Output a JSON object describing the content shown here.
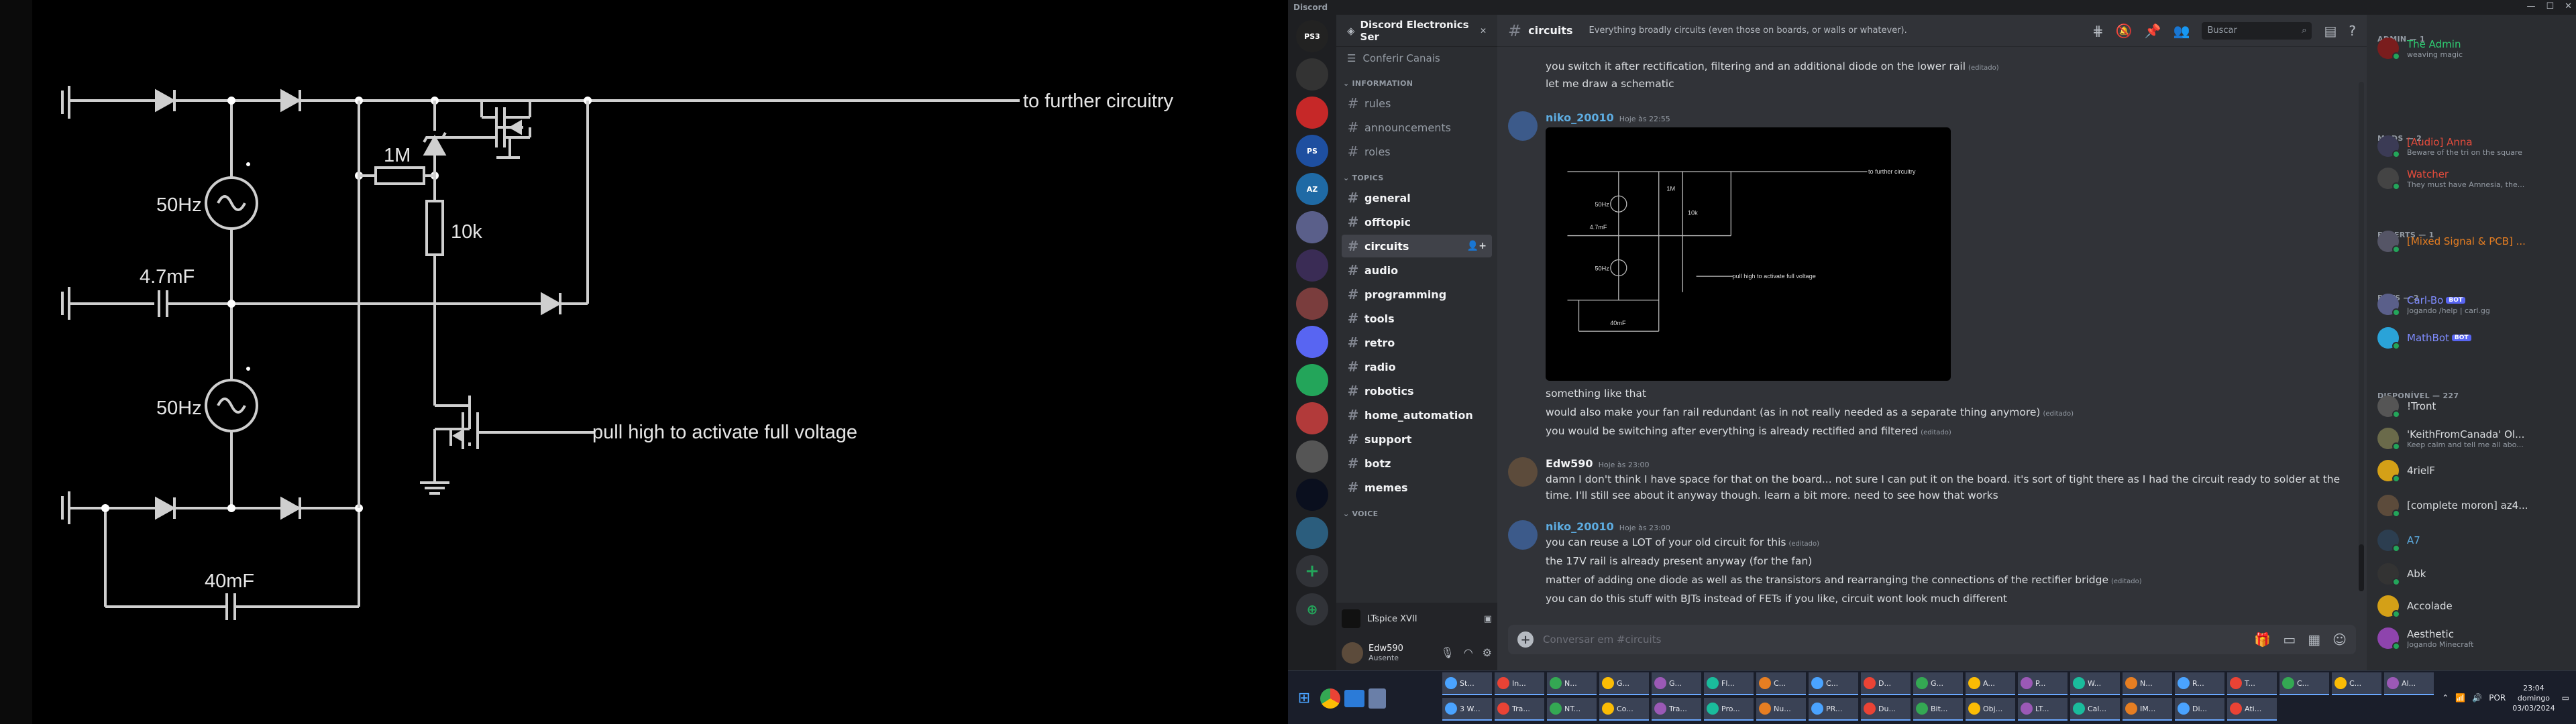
{
  "schematic": {
    "labels": {
      "out": "to further circuitry",
      "freq1": "50Hz",
      "freq2": "50Hz",
      "cap1": "4.7mF",
      "cap2": "40mF",
      "r1": "1M",
      "r2": "10k",
      "ctrl": "pull high to activate full voltage"
    }
  },
  "window": {
    "title": "Discord"
  },
  "servers": [
    {
      "name": "PS3",
      "color": "#222"
    },
    {
      "name": "",
      "color": "#333"
    },
    {
      "name": "",
      "color": "#c62828"
    },
    {
      "name": "PS",
      "color": "#1e4fa0"
    },
    {
      "name": "AZ",
      "color": "#1f6aa5"
    },
    {
      "name": "",
      "color": "#5a5f8a"
    },
    {
      "name": "",
      "color": "#3a2c55"
    },
    {
      "name": "",
      "color": "#7a3d3d"
    },
    {
      "name": "",
      "color": "#5865f2"
    },
    {
      "name": "",
      "color": "#23a55a"
    },
    {
      "name": "",
      "color": "#b23a3a"
    },
    {
      "name": "",
      "color": "#555"
    },
    {
      "name": "",
      "color": "#0a0f1e"
    },
    {
      "name": "",
      "color": "#2b5d7d"
    }
  ],
  "guild": {
    "name": "Discord Electronics Ser",
    "browse": "Conferir Canais"
  },
  "categories": {
    "info": "INFORMATION",
    "topics": "TOPICS",
    "voice": "VOICE"
  },
  "info_channels": [
    "rules",
    "announcements",
    "roles"
  ],
  "topic_channels": [
    "general",
    "offtopic",
    "circuits",
    "audio",
    "programming",
    "tools",
    "retro",
    "radio",
    "robotics",
    "home_automation",
    "support",
    "botz",
    "memes"
  ],
  "activity": {
    "label": "LTspice XVII"
  },
  "user": {
    "name": "Edw590",
    "status": "Ausente"
  },
  "channel": {
    "name": "circuits",
    "topic": "Everything broadly circuits (even those on boards, or walls or whatever).",
    "search_placeholder": "Buscar",
    "composer_placeholder": "Conversar em #circuits"
  },
  "messages": {
    "top1": "you switch it after rectification, filtering and an additional diode on the lower rail",
    "top1_edited": "(editado)",
    "top2": "let me draw a schematic",
    "g1_author": "niko_20010",
    "g1_ts": "Hoje às 22:55",
    "g1_l1": "something like that",
    "g1_l2": "would also make your fan rail redundant (as in not really needed as a separate thing anymore)",
    "g1_l2_edited": "(editado)",
    "g1_l3": "you would be switching after everything is already rectified and filtered",
    "g1_l3_edited": "(editado)",
    "g2_author": "Edw590",
    "g2_ts": "Hoje às 23:00",
    "g2_l1": "damn I don't think I have space for that on the board... not sure I can put it on the board. it's sort of tight there as I had the circuit ready to solder at the",
    "g2_l2": "time. I'll still see about it anyway though. learn a bit more. need to see how that works",
    "g3_author": "niko_20010",
    "g3_ts": "Hoje às 23:00",
    "g3_l1": "you can reuse a LOT of your old circuit for this",
    "g3_l1_edited": "(editado)",
    "g3_l2": "the 17V rail is already present anyway (for the fan)",
    "g3_l3": "matter of adding one diode as well as the transistors and rearranging the connections of the rectifier bridge",
    "g3_l3_edited": "(editado)",
    "g3_l4": "you can do this stuff with BJTs instead of FETs if you like, circuit wont look much different"
  },
  "members": {
    "admin_cat": "ADMIN — 1",
    "mods_cat": "MODS — 2",
    "experts_cat": "EXPERTS — 1",
    "bots_cat": "BOTS — 2",
    "online_cat": "DISPONÍVEL — 227",
    "list": [
      {
        "name": "The Admin",
        "status": "weaving magic",
        "color": "#2ecc71",
        "av": "#7a1d1d"
      },
      {
        "name": "[Audio] Anna",
        "status": "Beware of the tri on the square",
        "color": "#e74c3c",
        "av": "#3b3b55"
      },
      {
        "name": "Watcher",
        "status": "They must have Amnesia, the...",
        "color": "#e74c3c",
        "av": "#444"
      },
      {
        "name": "[Mixed Signal & PCB] ...",
        "status": "",
        "color": "#e67e22",
        "av": "#556"
      },
      {
        "name": "Carl-Bo",
        "status": "Jogando /help | carl.gg",
        "color": "#7f8cff",
        "av": "#5a5f8a",
        "badge": "BOT"
      },
      {
        "name": "MathBot",
        "status": "",
        "color": "#7f8cff",
        "av": "#2aa3d8",
        "badge": "BOT"
      },
      {
        "name": "!Tront",
        "status": "",
        "color": "#dbdee1",
        "av": "#555"
      },
      {
        "name": "'KeithFromCanada' Ol...",
        "status": "Keep calm and tell me all abo...",
        "color": "#dbdee1",
        "av": "#6a6a4a"
      },
      {
        "name": "4rielF",
        "status": "",
        "color": "#dbdee1",
        "av": "#d4a017"
      },
      {
        "name": "[complete moron] az4...",
        "status": "",
        "color": "#dbdee1",
        "av": "#5c4b3b"
      },
      {
        "name": "A7",
        "status": "",
        "color": "#5dade2",
        "av": "#2c3e50"
      },
      {
        "name": "Abk",
        "status": "",
        "color": "#dbdee1",
        "av": "#333"
      },
      {
        "name": "Accolade",
        "status": "",
        "color": "#dbdee1",
        "av": "#d4a017"
      },
      {
        "name": "Aesthetic",
        "status": "Jogando Minecraft",
        "color": "#dbdee1",
        "av": "#8e44ad"
      }
    ]
  },
  "taskbar": {
    "row1": [
      "St...",
      "In...",
      "N...",
      "G...",
      "G...",
      "Fl...",
      "C...",
      "C...",
      "D...",
      "G...",
      "A...",
      "P...",
      "W...",
      "N...",
      "R...",
      "T...",
      "C...",
      "C...",
      "Al..."
    ],
    "row2": [
      "3 W...",
      "Tra...",
      "NT...",
      "Co...",
      "Tra...",
      "Pro...",
      "Nu...",
      "PR...",
      "Du...",
      "Bit...",
      "Obj...",
      "LT...",
      "Cal...",
      "IM...",
      "Di...",
      "Ati..."
    ],
    "lang": "POR",
    "time": "23:04",
    "day": "domingo",
    "date": "03/03/2024"
  }
}
